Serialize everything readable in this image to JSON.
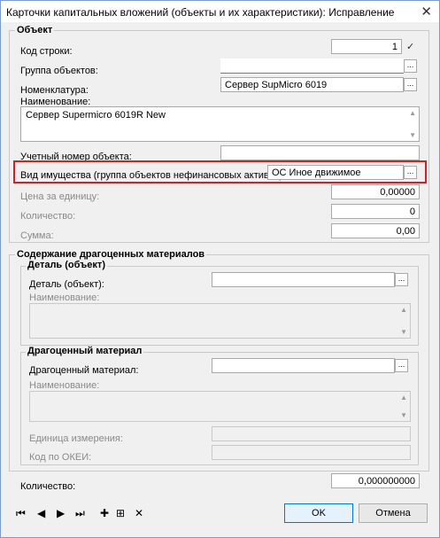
{
  "window": {
    "title": "Карточки капитальных вложений (объекты и их характеристики): Исправление",
    "close_glyph": "✕"
  },
  "object_section": {
    "legend": "Объект",
    "row_code": {
      "label": "Код строки:",
      "value": "1",
      "check_icon": "✓"
    },
    "object_group": {
      "label": "Группа объектов:",
      "value": ""
    },
    "nomenclature": {
      "label": "Номенклатура:",
      "value": "Сервер SupMicro 6019"
    },
    "name": {
      "label": "Наименование:",
      "value": "Сервер Supermicro 6019R New"
    },
    "account_number": {
      "label": "Учетный номер объекта:",
      "value": ""
    },
    "property_type": {
      "label": "Вид имущества (группа объектов нефинансовых активов):",
      "value": "ОС Иное движимое"
    },
    "unit_price": {
      "label": "Цена за единицу:",
      "value": "0,00000"
    },
    "quantity": {
      "label": "Количество:",
      "value": "0"
    },
    "sum": {
      "label": "Сумма:",
      "value": "0,00"
    }
  },
  "precious_section": {
    "legend": "Содержание драгоценных материалов",
    "detail": {
      "legend": "Деталь (объект)",
      "detail_field": {
        "label": "Деталь (объект):",
        "value": ""
      },
      "name": {
        "label": "Наименование:",
        "value": ""
      }
    },
    "material": {
      "legend": "Драгоценный материал",
      "material_field": {
        "label": "Драгоценный материал:",
        "value": ""
      },
      "name": {
        "label": "Наименование:",
        "value": ""
      },
      "unit": {
        "label": "Единица измерения:",
        "value": ""
      },
      "okei": {
        "label": "Код по ОКЕИ:",
        "value": ""
      }
    },
    "quantity": {
      "label": "Количество:",
      "value": "0,000000000"
    }
  },
  "toolbar": {
    "first": "⏮",
    "prev": "◀",
    "next": "▶",
    "last": "⏭",
    "add": "✚",
    "add_copy": "⊞",
    "delete": "✕"
  },
  "buttons": {
    "ok": "OK",
    "cancel": "Отмена"
  },
  "dots": "...",
  "scroll_up": "▲",
  "scroll_down": "▼",
  "colors": {
    "highlight": "#d42020",
    "window_bg": "#f0f0f0",
    "border": "#a9a9a9"
  }
}
